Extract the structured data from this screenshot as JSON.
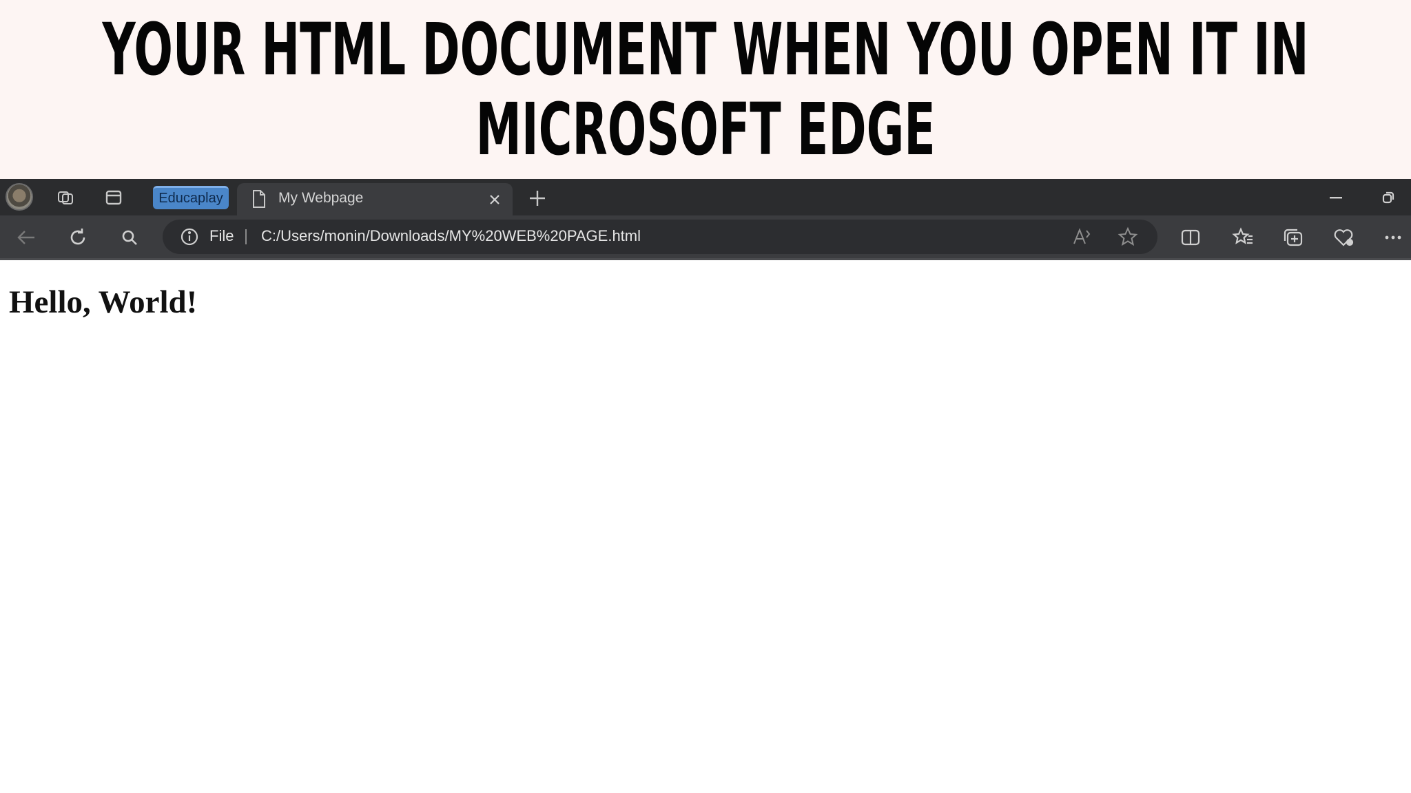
{
  "banner": {
    "line1": "YOUR HTML DOCUMENT WHEN YOU OPEN IT IN",
    "line2": "MICROSOFT EDGE"
  },
  "browser": {
    "tabs": {
      "pinned_label": "Educaplay",
      "active_title": "My Webpage"
    },
    "address": {
      "scheme_label": "File",
      "url": "C:/Users/monin/Downloads/MY%20WEB%20PAGE.html"
    },
    "icons": {
      "profile": "profile-avatar",
      "workspaces": "workspaces-icon",
      "tab_actions": "tab-actions-icon",
      "tab_page": "page-icon",
      "tab_close": "close-icon",
      "new_tab": "plus-icon",
      "minimize": "minimize-icon",
      "restore": "restore-icon",
      "back": "back-arrow-icon",
      "refresh": "refresh-icon",
      "search": "search-icon",
      "info": "info-icon",
      "read_aloud": "read-aloud-icon",
      "favorite": "star-icon",
      "split_screen": "split-screen-icon",
      "favorites": "favorites-icon",
      "collections": "collections-icon",
      "browser_essentials": "heart-icon",
      "more": "more-icon"
    },
    "colors": {
      "tabbar": "#2b2c2e",
      "toolbar": "#3b3c3f",
      "pinned_tab": "#4a86c9"
    }
  },
  "page": {
    "heading": "Hello, World!"
  }
}
